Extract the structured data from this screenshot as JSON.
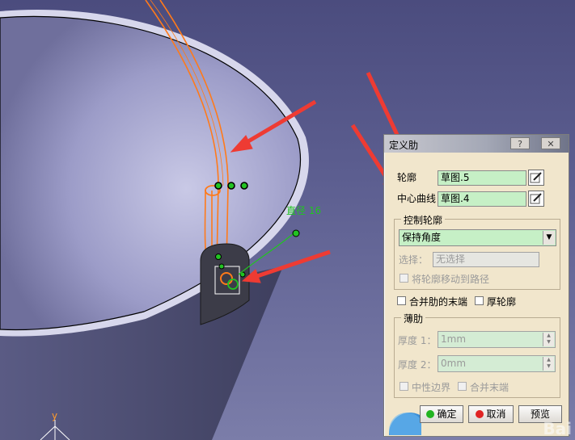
{
  "viewport": {
    "dimension_label": "直径 16",
    "compass_label": "y"
  },
  "dialog": {
    "title": "定义肋",
    "help_button": "?",
    "close_button": "✕",
    "profile": {
      "label": "轮廓",
      "value": "草图.5"
    },
    "center_curve": {
      "label": "中心曲线",
      "value": "草图.4"
    },
    "control_profile": {
      "legend": "控制轮廓",
      "mode": "保持角度",
      "selection_label": "选择：",
      "selection_value": "无选择",
      "move_profile_label": "将轮廓移动到路径"
    },
    "merge_ends_label": "合并肋的末端",
    "thick_profile_label": "厚轮廓",
    "thin_rib": {
      "legend": "薄肋",
      "thickness1_label": "厚度 1：",
      "thickness1_value": "1mm",
      "thickness2_label": "厚度 2：",
      "thickness2_value": "0mm",
      "neutral_fiber_label": "中性边界",
      "merge_ends_label": "合并末端"
    },
    "ok_label": "确定",
    "cancel_label": "取消",
    "preview_label": "预览"
  },
  "watermark": "Bai",
  "colors": {
    "background": "#5c5e90",
    "dialog_bg": "#f1e6cc",
    "green_field": "#c6f0c6",
    "orange": "#ff7a1a",
    "arrow_red": "#ee3b33",
    "dimension_green": "#22c322"
  }
}
